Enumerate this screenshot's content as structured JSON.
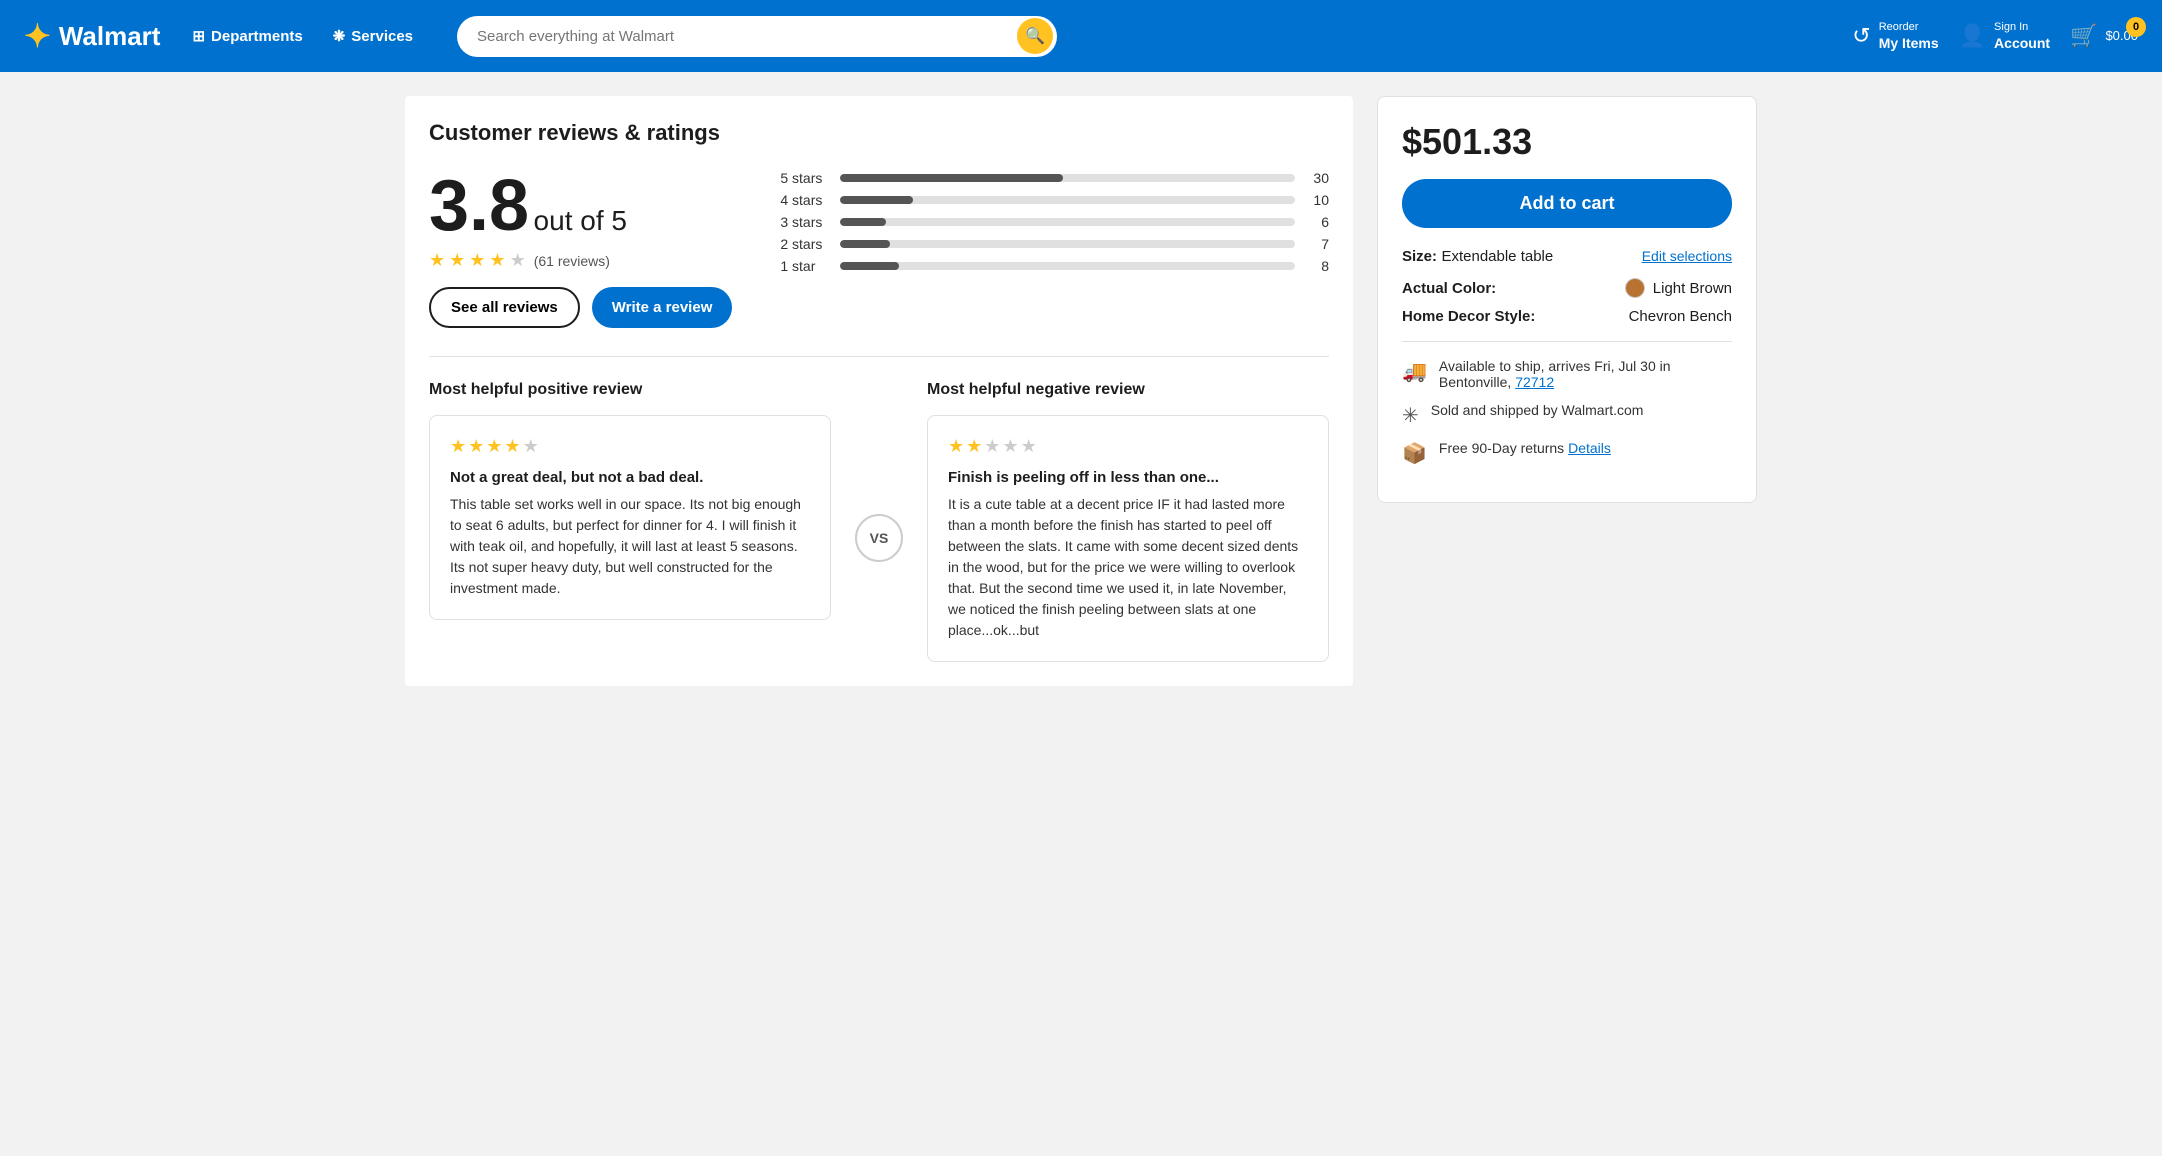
{
  "header": {
    "logo_text": "Walmart",
    "spark_symbol": "✦",
    "departments_label": "Departments",
    "services_label": "Services",
    "search_placeholder": "Search everything at Walmart",
    "reorder_line1": "Reorder",
    "reorder_line2": "My Items",
    "signin_line1": "Sign In",
    "signin_line2": "Account",
    "cart_amount": "$0.00",
    "cart_count": "0"
  },
  "reviews": {
    "section_title": "Customer reviews & ratings",
    "rating_value": "3.8",
    "rating_out_of": "out of",
    "rating_max": "5",
    "review_count_text": "(61 reviews)",
    "see_all_label": "See all reviews",
    "write_review_label": "Write a review",
    "stars": [
      {
        "label": "5 stars",
        "count": 30,
        "pct": 49
      },
      {
        "label": "4 stars",
        "count": 10,
        "pct": 16
      },
      {
        "label": "3 stars",
        "count": 6,
        "pct": 10
      },
      {
        "label": "2 stars",
        "count": 7,
        "pct": 11
      },
      {
        "label": "1 star",
        "count": 8,
        "pct": 13
      }
    ],
    "positive_section_title": "Most helpful positive review",
    "negative_section_title": "Most helpful negative review",
    "vs_text": "VS",
    "positive_review": {
      "stars": 4,
      "headline": "Not a great deal, but not a bad deal.",
      "body": "This table set works well in our space. Its not big enough to seat 6 adults, but perfect for dinner for 4. I will finish it with teak oil, and hopefully, it will last at least 5 seasons. Its not super heavy duty, but well constructed for the investment made."
    },
    "negative_review": {
      "stars": 2,
      "headline": "Finish is peeling off in less than one...",
      "body": "It is a cute table at a decent price IF it had lasted more than a month before the finish has started to peel off between the slats. It came with some decent sized dents in the wood, but for the price we were willing to overlook that. But the second time we used it, in late November, we noticed the finish peeling between slats at one place...ok...but"
    }
  },
  "product": {
    "price": "$501.33",
    "add_to_cart_label": "Add to cart",
    "size_label": "Size:",
    "size_value": "Extendable table",
    "edit_selections_label": "Edit selections",
    "color_label": "Actual Color:",
    "color_value": "Light Brown",
    "color_hex": "#b87333",
    "style_label": "Home Decor Style:",
    "style_value": "Chevron Bench",
    "shipping_text": "Available to ship, arrives Fri, Jul 30 in Bentonville,",
    "zip_code": "72712",
    "sold_by": "Sold and shipped by Walmart.com",
    "returns": "Free 90-Day returns",
    "returns_link": "Details"
  }
}
